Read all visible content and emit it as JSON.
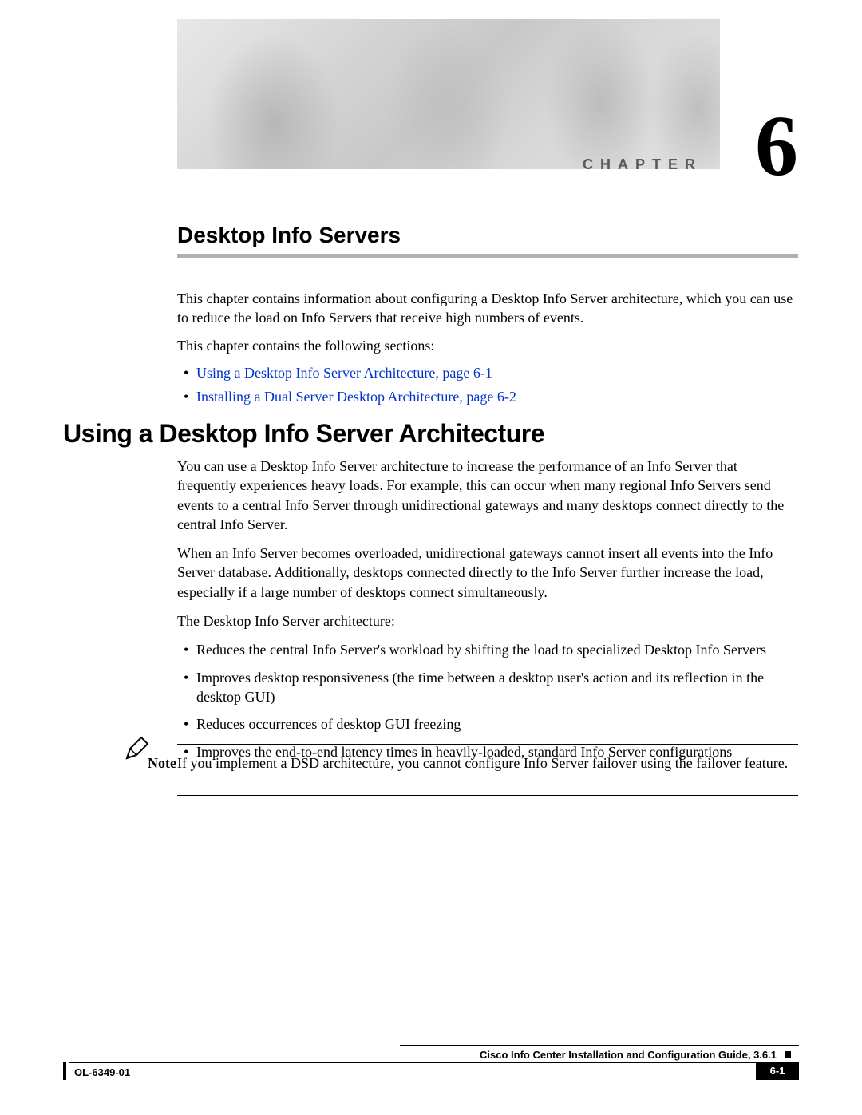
{
  "chapter": {
    "label": "CHAPTER",
    "number": "6",
    "title": "Desktop Info Servers"
  },
  "intro": {
    "p1": "This chapter contains information about configuring a Desktop Info Server architecture, which you can use to reduce the load on Info Servers that receive high numbers of events.",
    "p2": "This chapter contains the following sections:",
    "toc": [
      "Using a Desktop Info Server Architecture, page 6-1",
      "Installing a Dual Server Desktop Architecture, page 6-2"
    ]
  },
  "section1": {
    "heading": "Using a Desktop Info Server Architecture",
    "p1": "You can use a Desktop Info Server architecture to increase the performance of an Info Server that frequently experiences heavy loads. For example, this can occur when many regional Info Servers send events to a central Info Server through unidirectional gateways and many desktops connect directly to the central Info Server.",
    "p2": "When an Info Server becomes overloaded, unidirectional gateways cannot insert all events into the Info Server database. Additionally, desktops connected directly to the Info Server further increase the load, especially if a large number of desktops connect simultaneously.",
    "p3": "The Desktop Info Server architecture:",
    "bullets": [
      "Reduces the central Info Server's workload by shifting the load to specialized Desktop Info Servers",
      "Improves desktop responsiveness (the time between a desktop user's action and its reflection in the desktop GUI)",
      "Reduces occurrences of desktop GUI freezing",
      "Improves the end-to-end latency times in heavily-loaded, standard Info Server configurations"
    ]
  },
  "note": {
    "label": "Note",
    "text": "If you implement a DSD architecture, you cannot configure Info Server failover using the failover feature."
  },
  "footer": {
    "guide": "Cisco Info Center Installation and Configuration Guide, 3.6.1",
    "doc": "OL-6349-01",
    "page": "6-1"
  }
}
